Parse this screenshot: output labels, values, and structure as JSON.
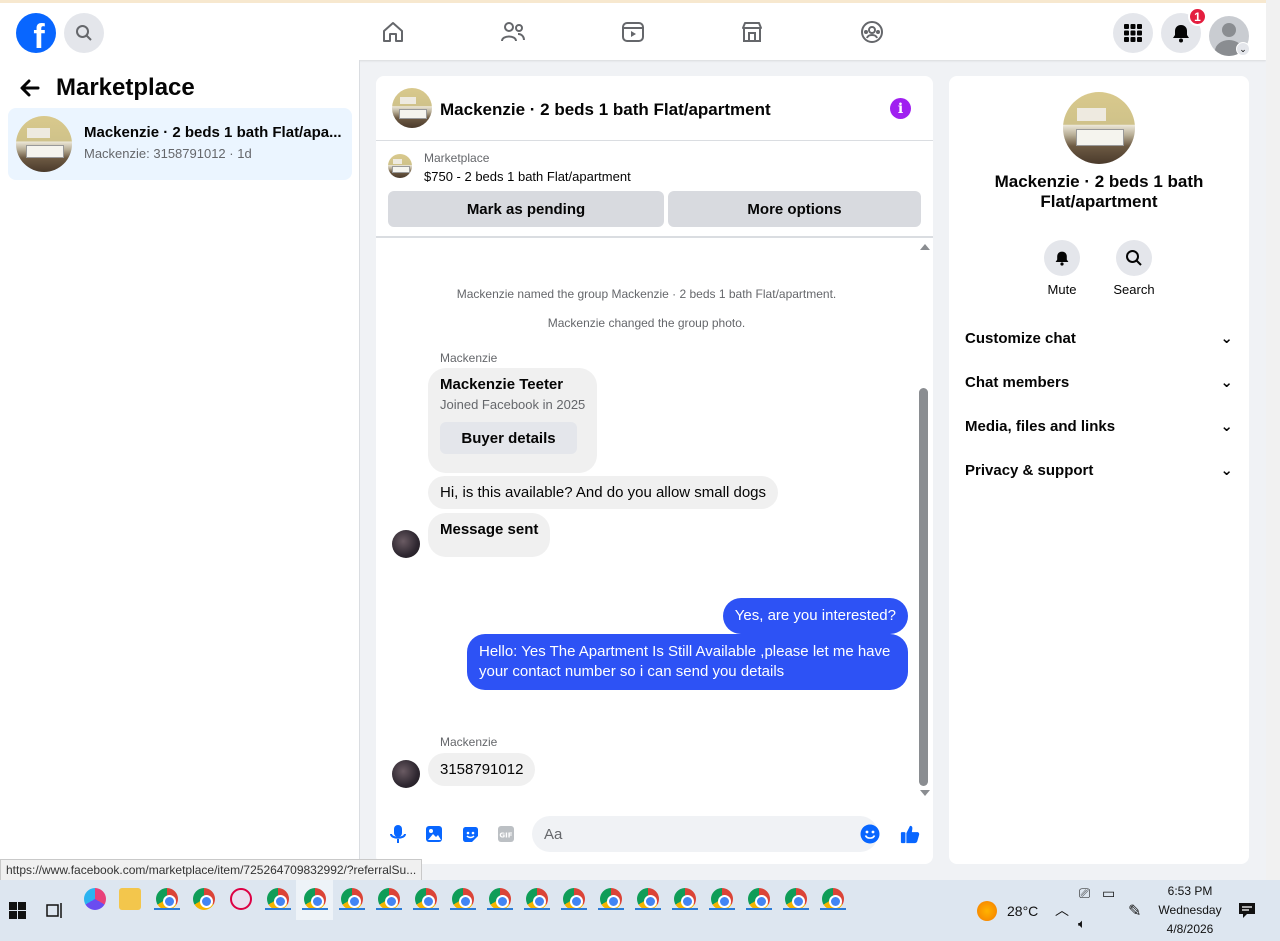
{
  "topbar": {
    "logo": "f",
    "notification_count": "1",
    "icons": [
      "search-icon",
      "home-icon",
      "friends-icon",
      "video-icon",
      "marketplace-icon",
      "groups-icon",
      "menu-grid-icon",
      "bell-icon",
      "profile-avatar"
    ]
  },
  "sidebar": {
    "title": "Marketplace",
    "conversation": {
      "title": "Mackenzie · 2 beds 1 bath Flat/apa...",
      "subtitle": "Mackenzie: 3158791012 · 1d"
    }
  },
  "chat": {
    "title": "Mackenzie · 2 beds 1 bath Flat/apartment",
    "listing_category": "Marketplace",
    "listing_price_title": "$750 - 2 beds 1 bath Flat/apartment",
    "mark_pending_label": "Mark as pending",
    "more_options_label": "More options",
    "system_messages": [
      "Mackenzie named the group Mackenzie · 2 beds 1 bath Flat/apartment.",
      "Mackenzie changed the group photo."
    ],
    "sender_name": "Mackenzie",
    "buyer_card": {
      "name": "Mackenzie Teeter",
      "joined": "Joined Facebook in 2025",
      "button": "Buyer details"
    },
    "incoming_1": "Hi, is this available? And do you allow small dogs",
    "incoming_2": "Message sent",
    "outgoing_1": "Yes, are you interested?",
    "outgoing_2": "Hello: Yes The Apartment Is Still Available ,please let me have your contact number so i can send you details",
    "sender_name_2": "Mackenzie",
    "incoming_3": "3158791012",
    "composer_placeholder": "Aa"
  },
  "right_panel": {
    "title": "Mackenzie · 2 beds 1 bath Flat/apartment",
    "mute_label": "Mute",
    "search_label": "Search",
    "sections": [
      "Customize chat",
      "Chat members",
      "Media, files and links",
      "Privacy & support"
    ]
  },
  "status_url": "https://www.facebook.com/marketplace/item/725264709832992/?referralSu...",
  "taskbar": {
    "temperature": "28°C",
    "time": "6:53 PM",
    "day": "Wednesday",
    "date": "4/8/2026"
  },
  "colors": {
    "brand": "#0866ff",
    "outgoing_bubble": "#2d52f5",
    "info_icon": "#a020f0",
    "badge": "#e41e3f"
  }
}
